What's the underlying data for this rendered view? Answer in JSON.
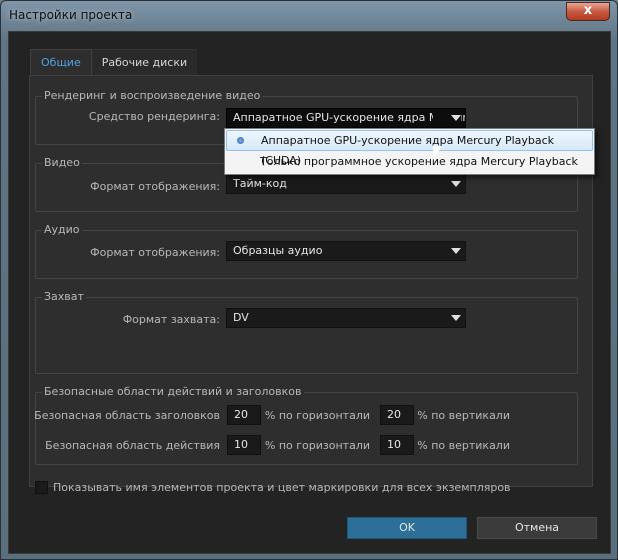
{
  "window": {
    "title": "Настройки проекта",
    "close_glyph": "x"
  },
  "tabs": [
    {
      "label": "Общие",
      "active": true
    },
    {
      "label": "Рабочие диски",
      "active": false
    }
  ],
  "render": {
    "group_label": "Рендеринг и воспроизведение видео",
    "engine_label": "Средство рендеринга:",
    "engine_value": "Аппаратное GPU-ускорение ядра Mercury Playback (CUDA)",
    "options": [
      "Аппаратное GPU-ускорение ядра Mercury Playback (CUDA)",
      "Только программное ускорение ядра Mercury Playback"
    ]
  },
  "video": {
    "group_label": "Видео",
    "format_label": "Формат отображения:",
    "format_value": "Тайм-код"
  },
  "audio": {
    "group_label": "Аудио",
    "format_label": "Формат отображения:",
    "format_value": "Образцы аудио"
  },
  "capture": {
    "group_label": "Захват",
    "format_label": "Формат захвата:",
    "format_value": "DV"
  },
  "safe": {
    "group_label": "Безопасные области действий и заголовков",
    "title_label": "Безопасная область заголовков",
    "title_h": "20",
    "title_v": "20",
    "action_label": "Безопасная область действия",
    "action_h": "10",
    "action_v": "10",
    "h_unit": "% по горизонтали",
    "v_unit": "% по вертикали"
  },
  "show_names_label": "Показывать имя элементов проекта и цвет маркировки для всех экземпляров",
  "buttons": {
    "ok": "OK",
    "cancel": "Отмена"
  },
  "colors": {
    "accent_tab": "#4fa3e3",
    "ok_button": "#2c6f99"
  }
}
